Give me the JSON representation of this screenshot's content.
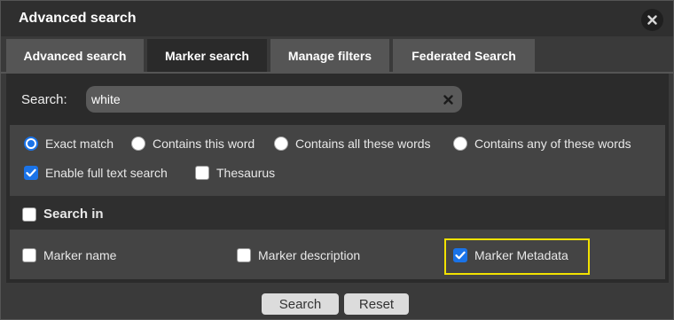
{
  "dialog": {
    "title": "Advanced search",
    "close_icon": "close-icon"
  },
  "tabs": [
    {
      "label": "Advanced search",
      "active": false
    },
    {
      "label": "Marker search",
      "active": true
    },
    {
      "label": "Manage filters",
      "active": false
    },
    {
      "label": "Federated Search",
      "active": false
    }
  ],
  "search": {
    "label": "Search:",
    "value": "white",
    "clear_icon": "clear-x-icon"
  },
  "match_modes": [
    {
      "label": "Exact match",
      "selected": true
    },
    {
      "label": "Contains this word",
      "selected": false
    },
    {
      "label": "Contains all these words",
      "selected": false
    },
    {
      "label": "Contains any of these words",
      "selected": false
    }
  ],
  "options": [
    {
      "label": "Enable full text search",
      "checked": true
    },
    {
      "label": "Thesaurus",
      "checked": false
    }
  ],
  "search_in": {
    "label": "Search in",
    "checked": false
  },
  "fields": [
    {
      "label": "Marker name",
      "checked": false
    },
    {
      "label": "Marker description",
      "checked": false
    },
    {
      "label": "Marker Metadata",
      "checked": true
    }
  ],
  "buttons": {
    "search": "Search",
    "reset": "Reset"
  },
  "colors": {
    "accent": "#1a73e8",
    "highlight": "#f2e200",
    "active_tab": "#2a2a2a",
    "inactive_tab": "#555555"
  }
}
